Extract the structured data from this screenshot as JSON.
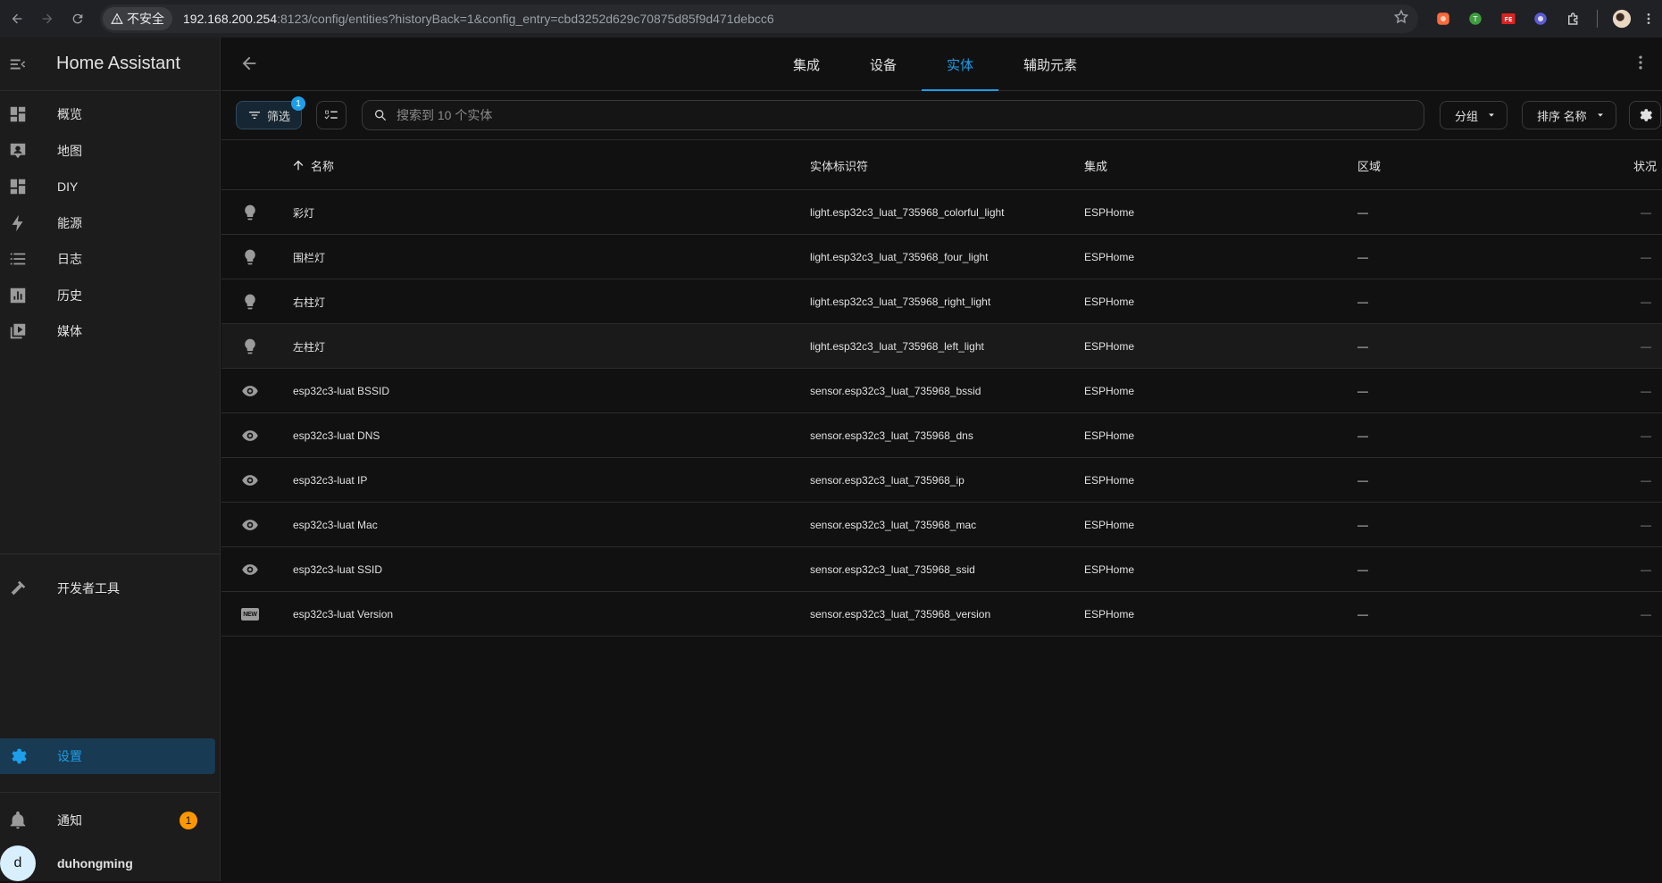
{
  "browser": {
    "security_label": "不安全",
    "url_host": "192.168.200.254",
    "url_path": ":8123/config/entities?historyBack=1&config_entry=cbd3252d629c70875d85f9d471debcc6"
  },
  "sidebar": {
    "title": "Home Assistant",
    "items": [
      {
        "label": "概览",
        "icon": "dashboard-icon"
      },
      {
        "label": "地图",
        "icon": "map-icon"
      },
      {
        "label": "DIY",
        "icon": "dashboard-icon"
      },
      {
        "label": "能源",
        "icon": "lightning-icon"
      },
      {
        "label": "日志",
        "icon": "list-icon"
      },
      {
        "label": "历史",
        "icon": "chart-icon"
      },
      {
        "label": "媒体",
        "icon": "media-icon"
      }
    ],
    "developer_tools": "开发者工具",
    "settings": "设置",
    "notifications": "通知",
    "notifications_count": "1",
    "user_initial": "d",
    "user_name": "duhongming"
  },
  "tabs": [
    "集成",
    "设备",
    "实体",
    "辅助元素"
  ],
  "active_tab": 2,
  "toolbar": {
    "filter_label": "筛选",
    "filter_count": "1",
    "search_placeholder": "搜索到 10 个实体",
    "group_label": "分组",
    "sort_label": "排序 名称"
  },
  "columns": {
    "name": "名称",
    "entity_id": "实体标识符",
    "integration": "集成",
    "area": "区域",
    "status": "状况"
  },
  "rows": [
    {
      "icon": "lightbulb-icon",
      "name": "彩灯",
      "entity_id": "light.esp32c3_luat_735968_colorful_light",
      "integration": "ESPHome",
      "area": "—",
      "status": "—"
    },
    {
      "icon": "lightbulb-icon",
      "name": "围栏灯",
      "entity_id": "light.esp32c3_luat_735968_four_light",
      "integration": "ESPHome",
      "area": "—",
      "status": "—"
    },
    {
      "icon": "lightbulb-icon",
      "name": "右柱灯",
      "entity_id": "light.esp32c3_luat_735968_right_light",
      "integration": "ESPHome",
      "area": "—",
      "status": "—"
    },
    {
      "icon": "lightbulb-icon",
      "name": "左柱灯",
      "entity_id": "light.esp32c3_luat_735968_left_light",
      "integration": "ESPHome",
      "area": "—",
      "status": "—"
    },
    {
      "icon": "eye-icon",
      "name": "esp32c3-luat BSSID",
      "entity_id": "sensor.esp32c3_luat_735968_bssid",
      "integration": "ESPHome",
      "area": "—",
      "status": "—"
    },
    {
      "icon": "eye-icon",
      "name": "esp32c3-luat DNS",
      "entity_id": "sensor.esp32c3_luat_735968_dns",
      "integration": "ESPHome",
      "area": "—",
      "status": "—"
    },
    {
      "icon": "eye-icon",
      "name": "esp32c3-luat IP",
      "entity_id": "sensor.esp32c3_luat_735968_ip",
      "integration": "ESPHome",
      "area": "—",
      "status": "—"
    },
    {
      "icon": "eye-icon",
      "name": "esp32c3-luat Mac",
      "entity_id": "sensor.esp32c3_luat_735968_mac",
      "integration": "ESPHome",
      "area": "—",
      "status": "—"
    },
    {
      "icon": "eye-icon",
      "name": "esp32c3-luat SSID",
      "entity_id": "sensor.esp32c3_luat_735968_ssid",
      "integration": "ESPHome",
      "area": "—",
      "status": "—"
    },
    {
      "icon": "new-box-icon",
      "name": "esp32c3-luat Version",
      "entity_id": "sensor.esp32c3_luat_735968_version",
      "integration": "ESPHome",
      "area": "—",
      "status": "—"
    }
  ],
  "colors": {
    "accent": "#1d9ee9",
    "badge": "#ff9800",
    "background": "#111111",
    "sidebar": "#1c1c1c"
  }
}
